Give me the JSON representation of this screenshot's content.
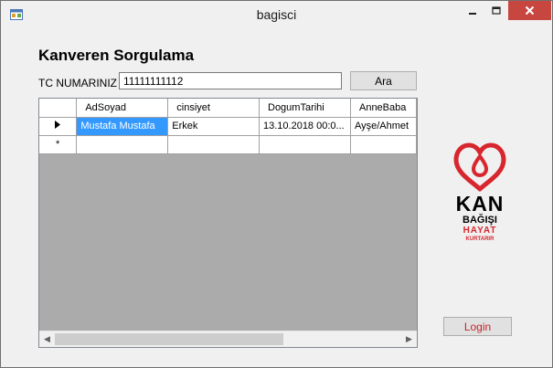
{
  "window": {
    "title": "bagisci"
  },
  "form": {
    "heading": "Kanveren Sorgulama",
    "tc_label": "TC NUMARINIZ",
    "tc_value": "11111111112",
    "search_button": "Ara",
    "login_button": "Login"
  },
  "grid": {
    "columns": [
      "AdSoyad",
      "cinsiyet",
      "DogumTarihi",
      "AnneBaba"
    ],
    "rows": [
      {
        "AdSoyad": "Mustafa Mustafa",
        "cinsiyet": "Erkek",
        "DogumTarihi": "13.10.2018 00:0...",
        "AnneBaba": "Ayşe/Ahmet"
      }
    ],
    "new_row_marker": "*",
    "current_row_marker": "▶"
  },
  "logo": {
    "line1": "KAN",
    "line2": "BAĞIŞI",
    "line3": "HAYAT",
    "line4": "KURTARIR"
  },
  "colors": {
    "brand_red": "#d7262e",
    "selection": "#3399ff",
    "close_button": "#c7463f"
  }
}
